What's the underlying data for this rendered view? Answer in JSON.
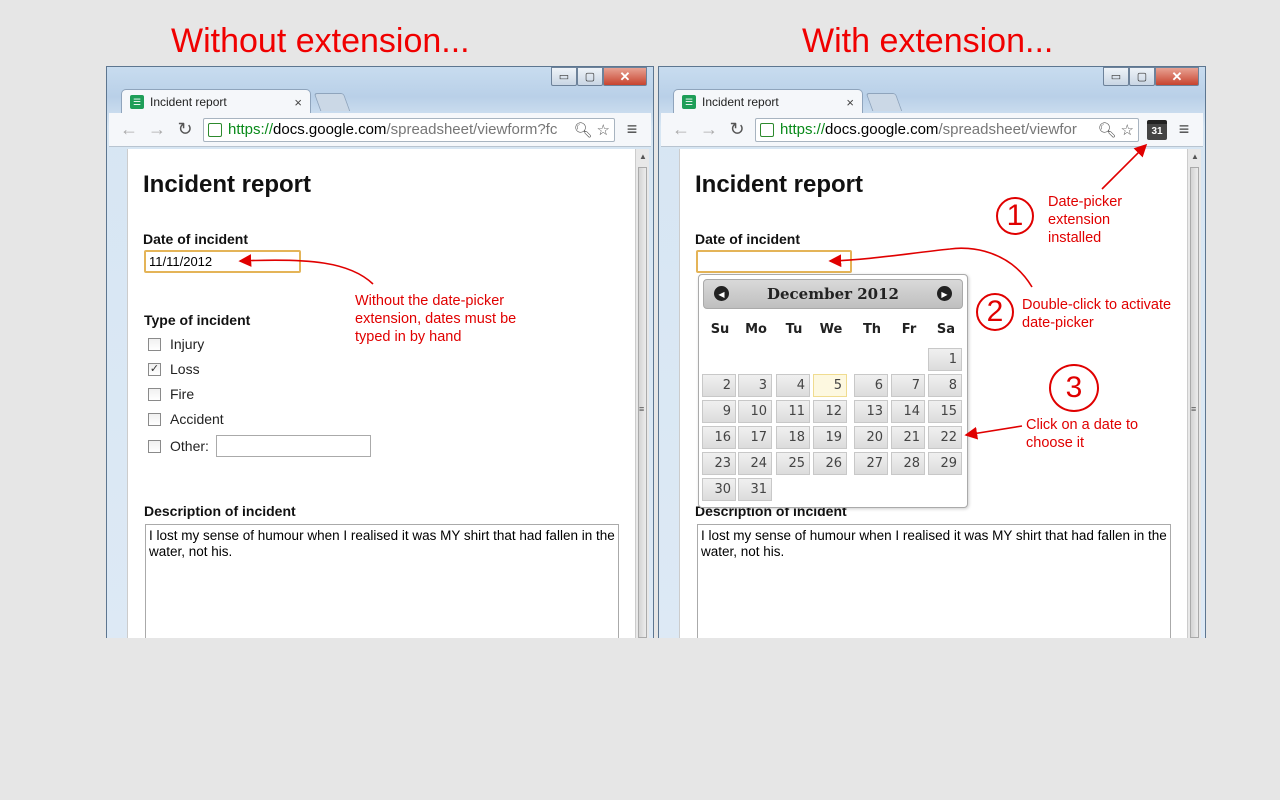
{
  "headings": {
    "left": "Without extension...",
    "right": "With extension..."
  },
  "browser": {
    "tab_title": "Incident report",
    "tab_close": "×",
    "url_scheme": "https://",
    "url_host": "docs.google.com",
    "url_path_left": "/spreadsheet/viewform?fc",
    "url_path_right": "/spreadsheet/viewfor",
    "extension_icon_label": "31",
    "window_controls": {
      "minimize": "▭",
      "maximize": "▢",
      "close": "✕"
    }
  },
  "form": {
    "title": "Incident report",
    "date_label": "Date of incident",
    "date_value_left": "11/11/2012",
    "date_value_right": "",
    "type_label": "Type of incident",
    "types": [
      {
        "label": "Injury",
        "checked": false
      },
      {
        "label": "Loss",
        "checked": true
      },
      {
        "label": "Fire",
        "checked": false
      },
      {
        "label": "Accident",
        "checked": false
      }
    ],
    "other_label": "Other:",
    "desc_label": "Description of incident",
    "desc_value": "I lost my sense of humour when I realised it was MY shirt that had fallen in the water, not his."
  },
  "calendar": {
    "month_label": "December 2012",
    "days_of_week": [
      "Su",
      "Mo",
      "Tu",
      "We",
      "Th",
      "Fr",
      "Sa"
    ],
    "first_weekday_index": 6,
    "days": [
      "1",
      "2",
      "3",
      "4",
      "5",
      "6",
      "7",
      "8",
      "9",
      "10",
      "11",
      "12",
      "13",
      "14",
      "15",
      "16",
      "17",
      "18",
      "19",
      "20",
      "21",
      "22",
      "23",
      "24",
      "25",
      "26",
      "27",
      "28",
      "29",
      "30",
      "31"
    ],
    "highlighted_day": "5"
  },
  "annotations": {
    "left_note": "Without the date-picker extension, dates must be typed in by hand",
    "step1_num": "1",
    "step1_text": "Date-picker extension installed",
    "step2_num": "2",
    "step2_text": "Double-click to activate date-picker",
    "step3_num": "3",
    "step3_text": "Click on a date to choose it",
    "color": "#e00000"
  }
}
